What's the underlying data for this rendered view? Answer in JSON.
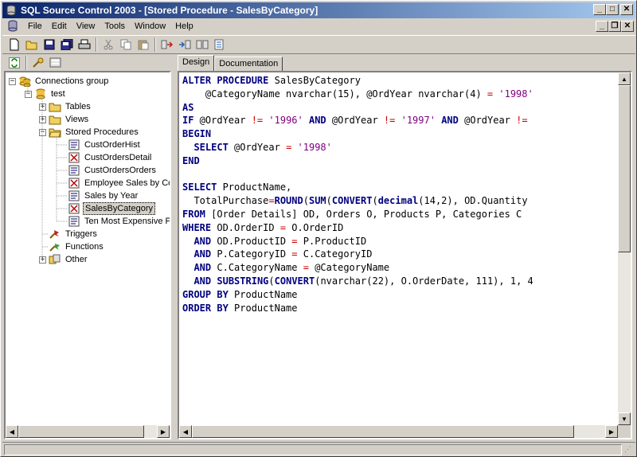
{
  "window": {
    "title": "SQL Source Control 2003 - [Stored Procedure - SalesByCategory]",
    "accent_color": "#0a246a"
  },
  "menu": [
    "File",
    "Edit",
    "View",
    "Tools",
    "Window",
    "Help"
  ],
  "toolbar": {
    "icons": [
      "new-icon",
      "open-icon",
      "save-icon",
      "save-all-icon",
      "print-icon",
      "cut-icon",
      "copy-icon",
      "paste-icon",
      "checkout-icon",
      "checkin-icon",
      "undo-checkout-icon",
      "history-icon"
    ]
  },
  "tree_toolbar": {
    "icons": [
      "refresh-icon",
      "connect-icon",
      "properties-icon"
    ]
  },
  "tree": {
    "root": "Connections group",
    "db": "test",
    "folders": {
      "tables": "Tables",
      "views": "Views",
      "stored_procedures": "Stored Procedures",
      "triggers": "Triggers",
      "functions": "Functions",
      "other": "Other"
    },
    "procedures": [
      "CustOrderHist",
      "CustOrdersDetail",
      "CustOrdersOrders",
      "Employee Sales by Cou",
      "Sales by Year",
      "SalesByCategory",
      "Ten Most Expensive Pr"
    ],
    "selected": "SalesByCategory"
  },
  "tabs": [
    "Design",
    "Documentation"
  ],
  "editor": {
    "lines": [
      "ALTER PROCEDURE SalesByCategory",
      "    @CategoryName nvarchar(15), @OrdYear nvarchar(4) = '1998'",
      "AS",
      "IF @OrdYear != '1996' AND @OrdYear != '1997' AND @OrdYear !=",
      "BEGIN",
      "  SELECT @OrdYear = '1998'",
      "END",
      "",
      "SELECT ProductName,",
      "  TotalPurchase=ROUND(SUM(CONVERT(decimal(14,2), OD.Quantity",
      "FROM [Order Details] OD, Orders O, Products P, Categories C",
      "WHERE OD.OrderID = O.OrderID",
      "  AND OD.ProductID = P.ProductID",
      "  AND P.CategoryID = C.CategoryID",
      "  AND C.CategoryName = @CategoryName",
      "  AND SUBSTRING(CONVERT(nvarchar(22), O.OrderDate, 111), 1, 4",
      "GROUP BY ProductName",
      "ORDER BY ProductName"
    ]
  },
  "status": {
    "text": ""
  }
}
